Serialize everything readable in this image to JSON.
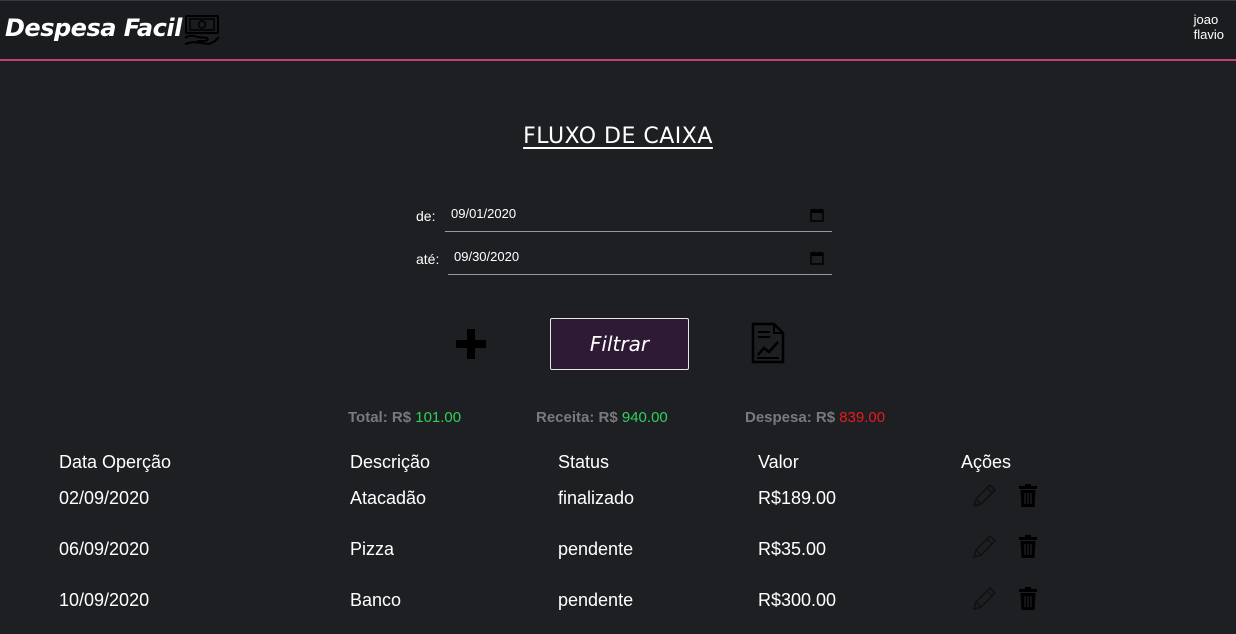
{
  "header": {
    "brand": "Despesa Facil",
    "user_first": "joao",
    "user_last": "flavio"
  },
  "page": {
    "title": "FLUXO DE CAIXA"
  },
  "filter": {
    "from_label": "de:",
    "from_value": "09/01/2020",
    "to_label": "até:",
    "to_value": "09/30/2020",
    "filter_label": "Filtrar"
  },
  "summary": {
    "total_label": "Total: R$",
    "total_value": "101.00",
    "receita_label": "Receita: R$",
    "receita_value": "940.00",
    "despesa_label": "Despesa: R$",
    "despesa_value": "839.00"
  },
  "table": {
    "headers": [
      "Data Operção",
      "Descrição",
      "Status",
      "Valor",
      "Ações"
    ],
    "rows": [
      [
        "02/09/2020",
        "Atacadão",
        "finalizado",
        "R$189.00"
      ],
      [
        "06/09/2020",
        "Pizza",
        "pendente",
        "R$35.00"
      ],
      [
        "10/09/2020",
        "Banco",
        "pendente",
        "R$300.00"
      ]
    ]
  },
  "icons": {
    "brand": "money-hand-icon",
    "add": "plus-icon",
    "report": "report-chart-icon",
    "edit": "pencil-icon",
    "delete": "trash-icon",
    "calendar": "calendar-icon"
  },
  "colors": {
    "background": "#1e1f23",
    "accent_line": "#c2416e",
    "filter_button": "#2e1a34",
    "positive": "#2fd05a",
    "negative": "#e81b1b",
    "muted_label": "#7a7a7e"
  }
}
